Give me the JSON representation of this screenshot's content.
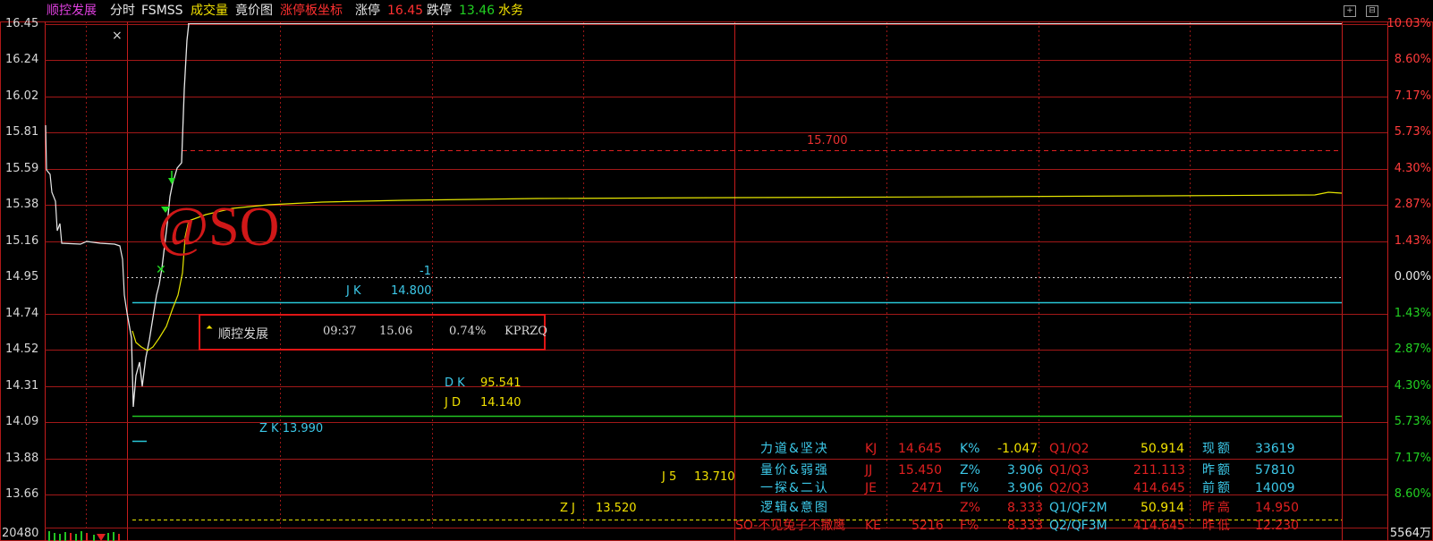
{
  "topbar": {
    "stock_name": "顺控发展",
    "mode": "分时",
    "indicator": "FSMSS",
    "volume": "成交量",
    "auction": "竟价图",
    "limit_coord": "涨停板坐标",
    "up_limit_label": "涨停",
    "up_limit_value": "16.45",
    "down_limit_label": "跌停",
    "down_limit_value": "13.46",
    "sector": "水务"
  },
  "y_axis_left": [
    "16.45",
    "16.24",
    "16.02",
    "15.81",
    "15.59",
    "15.38",
    "15.16",
    "14.95",
    "14.74",
    "14.52",
    "14.31",
    "14.09",
    "13.88",
    "13.66"
  ],
  "y_axis_right": [
    "10.03%",
    "8.60%",
    "7.17%",
    "5.73%",
    "4.30%",
    "2.87%",
    "1.43%",
    "0.00%",
    "1.43%",
    "2.87%",
    "4.30%",
    "5.73%",
    "7.17%",
    "8.60%"
  ],
  "volume_axis": {
    "left": "20480",
    "right": "5564万"
  },
  "levels": {
    "line_15700": "15.700",
    "jk_label": "J K",
    "jk_value": "14.800",
    "minus_one": "-1",
    "dk_label": "D K",
    "dk_value": "95.541",
    "jd_label": "J D",
    "jd_value": "14.140",
    "zk_label": "Z K 13.990",
    "j5_label": "J 5",
    "j5_value": "13.710",
    "zj_label": "Z J",
    "zj_value": "13.520"
  },
  "watermark": "@SO",
  "popup": {
    "name": "顺控发展",
    "time": "09:37",
    "price": "15.06",
    "pct": "0.74%",
    "code": "KPRZQ"
  },
  "info_panel": {
    "rows": [
      {
        "label": "力道&坚决",
        "k1": "KJ",
        "v1": "14.645",
        "k2": "K%",
        "v2": "-1.047",
        "k3": "Q1/Q2",
        "v3": "50.914",
        "k4": "现额",
        "v4": "33619"
      },
      {
        "label": "量价&弱强",
        "k1": "JJ",
        "v1": "15.450",
        "k2": "Z%",
        "v2": "3.906",
        "k3": "Q1/Q3",
        "v3": "211.113",
        "k4": "昨额",
        "v4": "57810"
      },
      {
        "label": "一探&二认",
        "k1": "JE",
        "v1": "2471",
        "k2": "F%",
        "v2": "3.906",
        "k3": "Q2/Q3",
        "v3": "414.645",
        "k4": "前额",
        "v4": "14009"
      },
      {
        "label": "逻辑&意图",
        "k1": "",
        "v1": "",
        "k2": "Z%",
        "v2": "8.333",
        "k3": "Q1/QF2M",
        "v3": "50.914",
        "k4": "昨高",
        "v4": "14.950"
      },
      {
        "label": "SO-不见兔子不撒鹰",
        "k1": "KE",
        "v1": "5216",
        "k2": "F%",
        "v2": "8.333",
        "k3": "Q2/QF3M",
        "v3": "414.645",
        "k4": "昨低",
        "v4": "12.230"
      }
    ]
  },
  "colors": {
    "grid": "#c41c1c",
    "price_line": "#e8e8e8",
    "avg_line": "#e6e600",
    "jk_line": "#28c8d8",
    "jd_line": "#22c422",
    "accent_red": "#ff3030",
    "yellow": "#f0e000",
    "cyan": "#3cc8e8"
  }
}
